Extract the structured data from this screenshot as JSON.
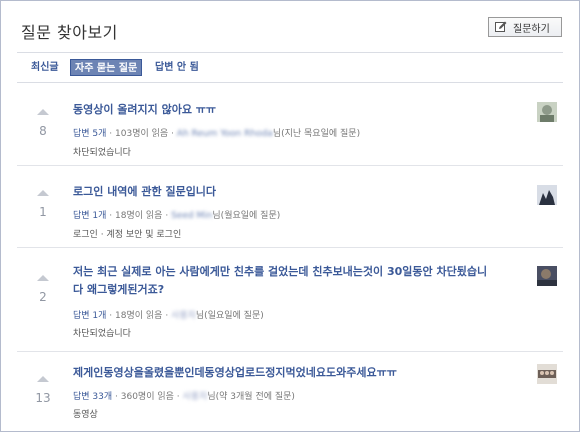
{
  "header": {
    "title": "질문 찾아보기",
    "ask_button_label": "질문하기"
  },
  "tabs": [
    {
      "label": "최신글",
      "active": false
    },
    {
      "label": "자주 묻는 질문",
      "active": true
    },
    {
      "label": "답변 안 됨",
      "active": false
    }
  ],
  "questions": [
    {
      "votes": "8",
      "title_lines": [
        "동영상이 올려지지 않아요 ㅠㅠ"
      ],
      "answers": "답변 5개",
      "views": "103명이 읽음",
      "author": "Ah Reum Yoon Rhoda",
      "author_suffix": "님(지난 목요일에 질문)",
      "tags": "차단되었습니다"
    },
    {
      "votes": "1",
      "title_lines": [
        "로그인 내역에 관한 질문입니다"
      ],
      "answers": "답변 1개",
      "views": "18명이 읽음",
      "author": "Seed Min",
      "author_suffix": "님(월요일에 질문)",
      "tags": "로그인 · 계정 보안 및 로그인"
    },
    {
      "votes": "2",
      "title_lines": [
        "저는 최근 실제로 아는 사람에게만 친추를 걸었는데 친추보내는것이 30일동안 차단됬습니",
        "다 왜그렇게된거죠?"
      ],
      "answers": "답변 1개",
      "views": "18명이 읽음",
      "author": "사용자",
      "author_suffix": "님(일요일에 질문)",
      "tags": "차단되었습니다"
    },
    {
      "votes": "13",
      "title_lines": [
        "제게인동영상을올렸을뿐인데동영상업로드정지먹었네요도와주세요ㅠㅠ"
      ],
      "answers": "답변 33개",
      "views": "360명이 읽음",
      "author": "사용자",
      "author_suffix": "님(약 3개월 전에 질문)",
      "tags": "동영상"
    }
  ],
  "colors": {
    "link": "#3b5998",
    "tab_active_bg": "#6d84b4",
    "border": "#b4bbcd"
  }
}
